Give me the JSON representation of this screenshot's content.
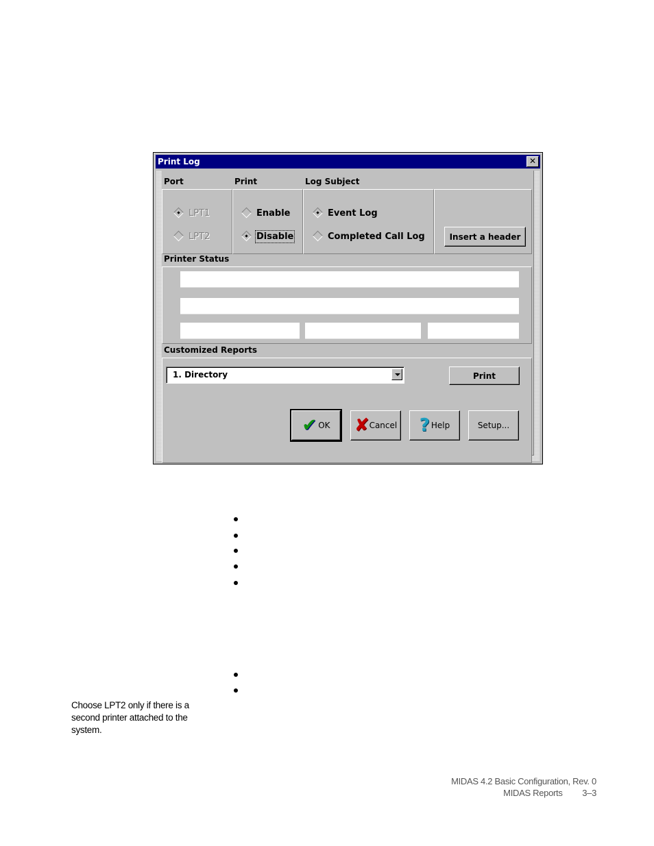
{
  "dialog": {
    "title": "Print Log",
    "close_label": "✕",
    "sections": {
      "port": "Port",
      "print": "Print",
      "log_subject": "Log Subject",
      "printer_status": "Printer Status",
      "customized_reports": "Customized Reports"
    },
    "port_options": [
      {
        "label": "LPT1",
        "selected": true,
        "enabled": false
      },
      {
        "label": "LPT2",
        "selected": false,
        "enabled": false
      }
    ],
    "print_options": [
      {
        "label": "Enable",
        "selected": false
      },
      {
        "label": "Disable",
        "selected": true
      }
    ],
    "log_subject_options": [
      {
        "label": "Event Log",
        "selected": true
      },
      {
        "label": "Completed Call Log",
        "selected": false
      }
    ],
    "insert_header_label": "Insert a header",
    "printer_status_fields": [
      "",
      "",
      "",
      "",
      ""
    ],
    "report_select": {
      "value": "1. Directory"
    },
    "print_button": "Print",
    "buttons": {
      "ok": "OK",
      "cancel": "Cancel",
      "help": "Help",
      "setup": "Setup..."
    },
    "icons": {
      "ok": "checkmark-icon",
      "cancel": "red-x-icon",
      "help": "question-mark-icon"
    }
  },
  "page": {
    "bullets_group1_count": 5,
    "bullets_group2_count": 2,
    "side_note": "Choose LPT2 only if there is a second printer attached to the system.",
    "footer_line1": "MIDAS 4.2 Basic Configuration, Rev. 0",
    "footer_section": "MIDAS Reports",
    "footer_page": "3–3"
  }
}
